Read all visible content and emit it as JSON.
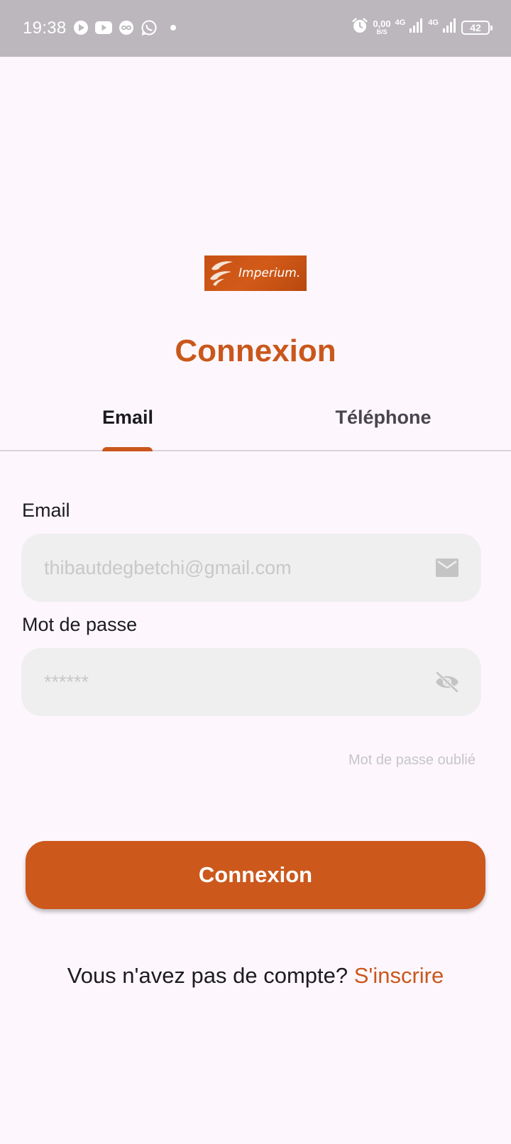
{
  "status_bar": {
    "time": "19:38",
    "net_speed_value": "0,00",
    "net_speed_unit": "B/S",
    "net_type_1": "4G",
    "net_type_2": "4G",
    "battery": "42"
  },
  "logo": {
    "text": "Imperium."
  },
  "page": {
    "title": "Connexion"
  },
  "tabs": [
    {
      "label": "Email",
      "active": true
    },
    {
      "label": "Téléphone",
      "active": false
    }
  ],
  "form": {
    "email_label": "Email",
    "email_placeholder": "thibautdegbetchi@gmail.com",
    "password_label": "Mot de passe",
    "password_placeholder": "******",
    "forgot_label": "Mot de passe oublié",
    "submit_label": "Connexion"
  },
  "signup": {
    "prompt": "Vous n'avez pas de compte? ",
    "link_label": "S'inscrire"
  },
  "colors": {
    "accent": "#c9571c",
    "background": "#fdf7fd",
    "status_bar": "#bbb7bc",
    "field_background": "#efefef"
  },
  "icons": {
    "email_field": "mail-icon",
    "password_field": "eye-off-icon"
  }
}
